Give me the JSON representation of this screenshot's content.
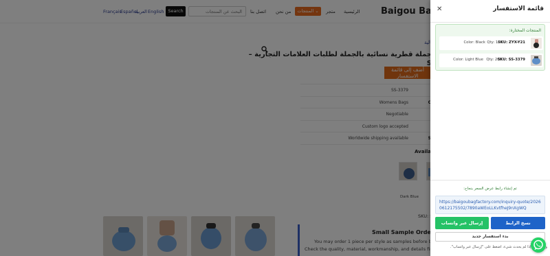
{
  "header": {
    "site_title": "Baigou Bag Fa",
    "languages": [
      "Français",
      "Español",
      "العربية",
      "English"
    ],
    "search_button": "Search",
    "search_placeholder": "البحث عن المنتجات",
    "nav": {
      "contact": "اتصل بنا",
      "about": "من نحن",
      "products": "المنتجات ⌄",
      "store": "متجر",
      "home": "الرئيسية"
    },
    "accent_color": "#e96b1e"
  },
  "product": {
    "breadcrumb": "مالية",
    "title_line1": "جملة قطرية نسائية بالجملة لطلبات العلامات التجارية –",
    "title_line2": "S",
    "add_to_quote_line1": "أضف إلى قائمة",
    "add_to_quote_line2": "الاستفسار",
    "specs": [
      {
        "value": "SS-3379",
        "extra": ""
      },
      {
        "value": "Womens Bags",
        "extra": "C"
      },
      {
        "value": "Negotiable",
        "extra": ""
      },
      {
        "value": "Custom logo accepted",
        "extra": ""
      },
      {
        "value": "Worldwide shipping available",
        "extra": "S"
      }
    ],
    "available_label": "Availab",
    "variant_label": "Dark Blue",
    "sku_line": "SKU: S",
    "sample": {
      "title": "Small Sample Orders Avai",
      "line1": "You may order 1 piece per style as samples before bulk prod",
      "line2": "Check the quality, material, workmanship, and details first before g"
    }
  },
  "drawer": {
    "title": "قائمة الاستفسار",
    "close_icon": "close-icon",
    "selected_label": "المنتجات المختارة:",
    "items": [
      {
        "sku": "SKU: ZYX-Y21",
        "qty": "Qty: 100",
        "color": "Color: Black"
      },
      {
        "sku": "SKU: SS-3379",
        "qty": "Qty: 200",
        "color": "Color: Light Blue"
      }
    ],
    "link_success": "تم إنشاء رابط عرض السعر بنجاح:",
    "link_url": "https://baigoubagfactory.com/inquiry-quote/20260612175502/7890aWEoLLKvtfheJ9nXgWQ",
    "copy_button": "نسخ الرابط",
    "whatsapp_button": "إرسال عبر واتساب",
    "new_inquiry_button": "بدء استفسار جديد",
    "hint": "واتساب... إذا لم يحدث شيء، اضغط على \"إرسال عبر واتساب\".",
    "primary_color": "#1e63c8",
    "whatsapp_color": "#25c266"
  },
  "floating": {
    "icon": "whatsapp-icon"
  }
}
